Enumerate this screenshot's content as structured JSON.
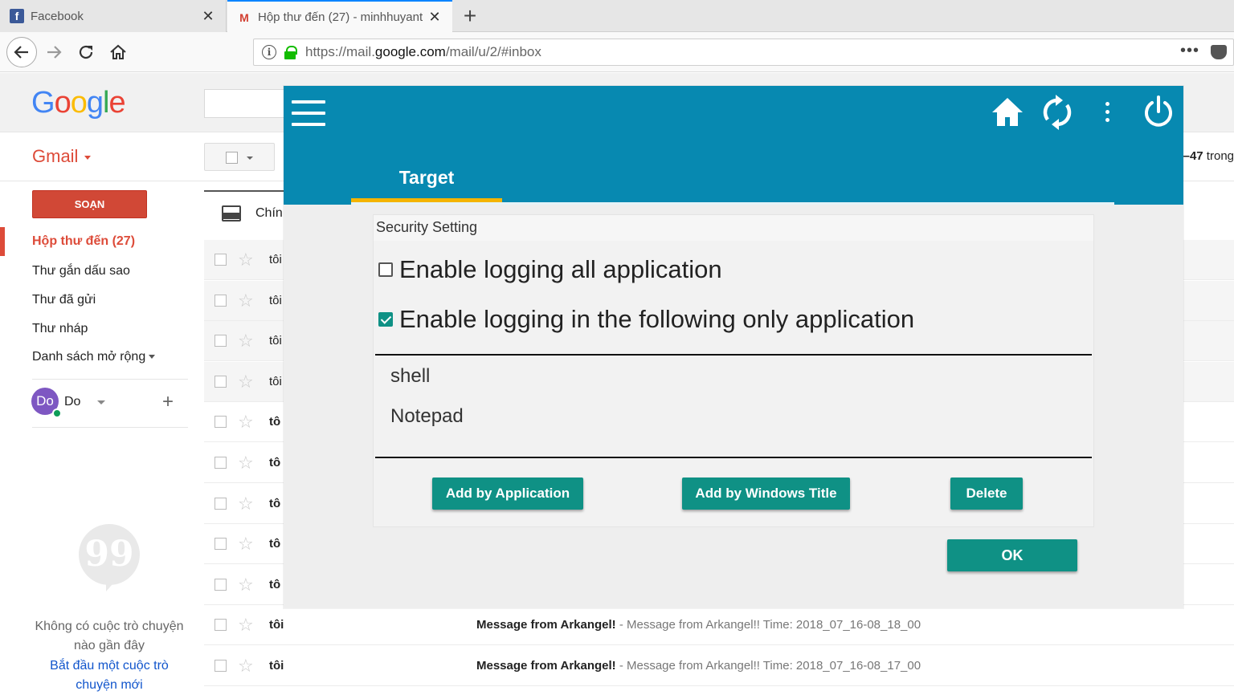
{
  "browser": {
    "tabs": [
      {
        "title": "Facebook",
        "icon": "facebook-icon"
      },
      {
        "title": "Hộp thư đến (27) - minhhuyant",
        "icon": "gmail-icon"
      }
    ],
    "new_tab": "+",
    "url": {
      "prefix": "https://mail.",
      "domain": "google.com",
      "path": "/mail/u/2/#inbox"
    },
    "more_glyph": "•••"
  },
  "gmail": {
    "logo": [
      "G",
      "o",
      "o",
      "g",
      "l",
      "e"
    ],
    "app_label": "Gmail",
    "compose": "SOẠN",
    "page_count_bold": "–47",
    "page_count_rest": " trong",
    "nav": {
      "inbox": "Hộp thư đến (27)",
      "starred": "Thư gắn dấu sao",
      "sent": "Thư đã gửi",
      "drafts": "Thư nháp",
      "more": "Danh sách mở rộng"
    },
    "hangouts": {
      "avatar": "Do",
      "name": "Do",
      "add": "+",
      "quote_glyph": "99",
      "no_chats": "Không có cuộc trò chuyện nào gần đây",
      "start_chat": "Bắt đầu một cuộc trò chuyện mới"
    },
    "inbox_tab": "Chín",
    "rows": [
      {
        "sender": "tôi",
        "unread": false,
        "subject": "",
        "snippet": ""
      },
      {
        "sender": "tôi",
        "unread": false,
        "subject": "",
        "snippet": ""
      },
      {
        "sender": "tôi",
        "unread": false,
        "subject": "",
        "snippet": ""
      },
      {
        "sender": "tôi",
        "unread": false,
        "subject": "",
        "snippet": ""
      },
      {
        "sender": "tô",
        "unread": true,
        "subject": "",
        "snippet": ""
      },
      {
        "sender": "tô",
        "unread": true,
        "subject": "",
        "snippet": ""
      },
      {
        "sender": "tô",
        "unread": true,
        "subject": "",
        "snippet": ""
      },
      {
        "sender": "tô",
        "unread": true,
        "subject": "",
        "snippet": ""
      },
      {
        "sender": "tô",
        "unread": true,
        "subject": "",
        "snippet": ""
      },
      {
        "sender": "tôi",
        "unread": true,
        "subject": "Message from Arkangel!",
        "snippet": " - Message from Arkangel!! Time: 2018_07_16-08_18_00"
      },
      {
        "sender": "tôi",
        "unread": true,
        "subject": "Message from Arkangel!",
        "snippet": " - Message from Arkangel!! Time: 2018_07_16-08_17_00"
      }
    ]
  },
  "dialog": {
    "tab": "Target",
    "section_title": "Security Setting",
    "option_all": "Enable logging all application",
    "option_all_checked": false,
    "option_only": "Enable logging in the following only application",
    "option_only_checked": true,
    "apps": [
      "shell",
      "Notepad"
    ],
    "buttons": {
      "add_by_app": "Add by Application",
      "add_by_title": "Add by Windows Title",
      "delete": "Delete",
      "ok": "OK"
    },
    "colors": {
      "header": "#0789b1",
      "accent": "#0f9185",
      "tab_indicator": "#f4b400"
    }
  }
}
